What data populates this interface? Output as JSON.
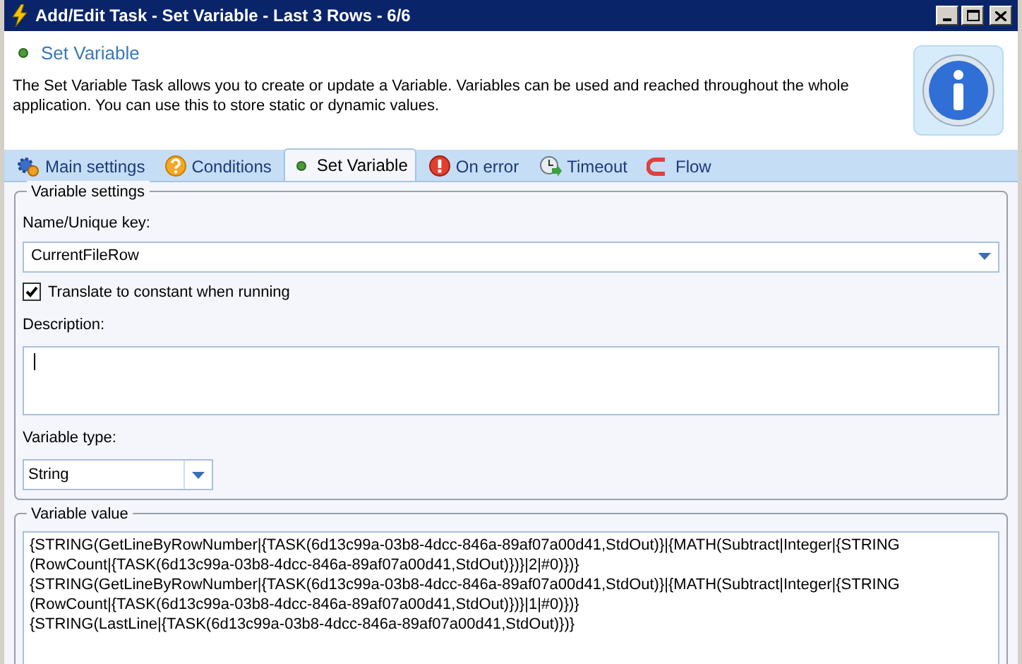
{
  "window": {
    "title": "Add/Edit Task - Set Variable - Last 3 Rows - 6/6"
  },
  "header": {
    "title": "Set Variable",
    "description": "The Set Variable Task allows you to create or update a Variable. Variables can be used and reached throughout the whole application. You can use this to store static or dynamic values."
  },
  "tabs": [
    {
      "label": "Main settings",
      "kind": "gear",
      "selected": false
    },
    {
      "label": "Conditions",
      "kind": "question",
      "selected": false
    },
    {
      "label": "Set Variable",
      "kind": "dot",
      "selected": true
    },
    {
      "label": "On error",
      "kind": "error",
      "selected": false
    },
    {
      "label": "Timeout",
      "kind": "clock",
      "selected": false
    },
    {
      "label": "Flow",
      "kind": "flow",
      "selected": false
    }
  ],
  "variable_settings": {
    "title": "Variable settings",
    "name_label": "Name/Unique key:",
    "name_value": "CurrentFileRow",
    "translate": {
      "label": "Translate to constant when running",
      "checked": true
    },
    "description_label": "Description:",
    "type_label": "Variable type:",
    "type_value": "String"
  },
  "variable_value": {
    "title": "Variable value",
    "lines": [
      "{STRING(GetLineByRowNumber|{TASK(6d13c99a-03b8-4dcc-846a-89af07a00d41,StdOut)}|{MATH(Subtract|Integer|{STRING",
      "(RowCount|{TASK(6d13c99a-03b8-4dcc-846a-89af07a00d41,StdOut)})}|2|#0)})}",
      "{STRING(GetLineByRowNumber|{TASK(6d13c99a-03b8-4dcc-846a-89af07a00d41,StdOut)}|{MATH(Subtract|Integer|{STRING",
      "(RowCount|{TASK(6d13c99a-03b8-4dcc-846a-89af07a00d41,StdOut)})}|1|#0)})}",
      "{STRING(LastLine|{TASK(6d13c99a-03b8-4dcc-846a-89af07a00d41,StdOut)})}"
    ]
  }
}
